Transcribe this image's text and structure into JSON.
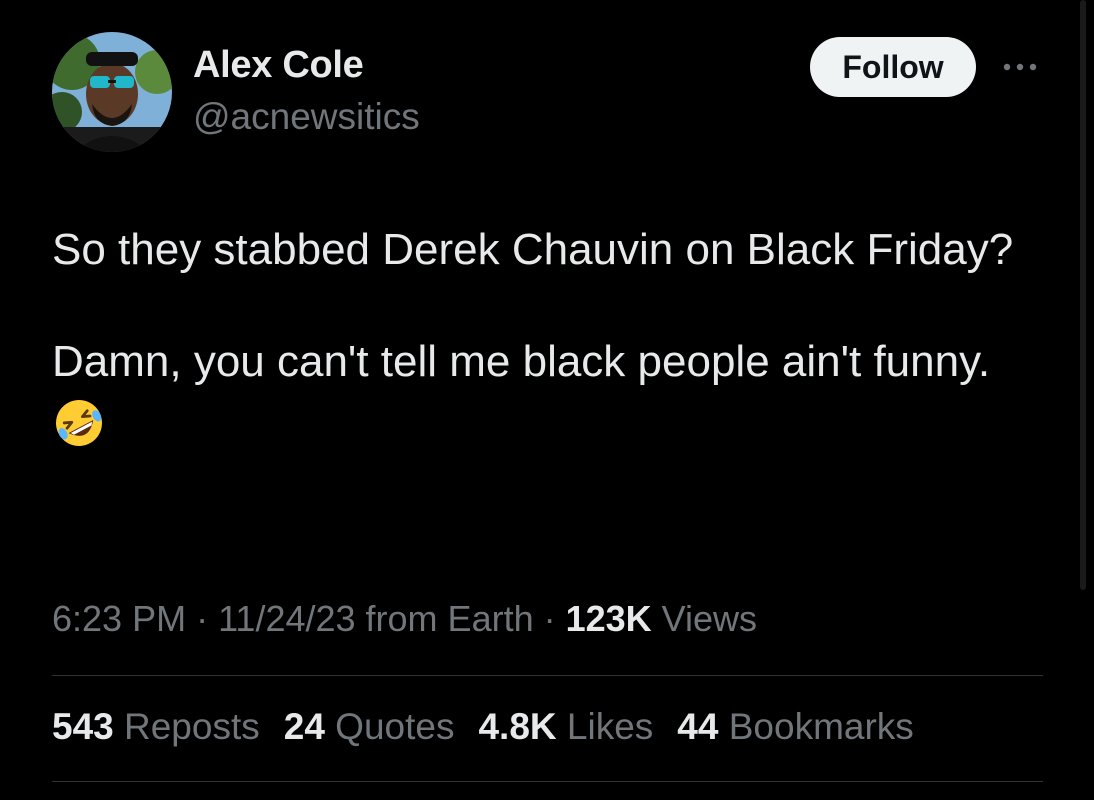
{
  "author": {
    "display_name": "Alex Cole",
    "handle": "@acnewsitics"
  },
  "actions": {
    "follow_label": "Follow",
    "more_icon": "more-horizontal-icon"
  },
  "tweet": {
    "paragraph_1": "So they stabbed Derek Chauvin on Black Friday?",
    "paragraph_2": "Damn, you can't tell me black people ain't funny.",
    "emoji": "rolling-on-floor-laughing-emoji"
  },
  "meta": {
    "time": "6:23 PM",
    "separator": " · ",
    "date": "11/24/23",
    "source": " from Earth",
    "views_count": "123K",
    "views_label": " Views"
  },
  "stats": {
    "reposts_count": "543",
    "reposts_label": " Reposts",
    "quotes_count": "24",
    "quotes_label": " Quotes",
    "likes_count": "4.8K",
    "likes_label": " Likes",
    "bookmarks_count": "44",
    "bookmarks_label": " Bookmarks"
  },
  "colors": {
    "background": "#000000",
    "primary_text": "#e7e9ea",
    "secondary_text": "#71767b",
    "follow_bg": "#eff3f4",
    "divider": "#2f3336"
  }
}
